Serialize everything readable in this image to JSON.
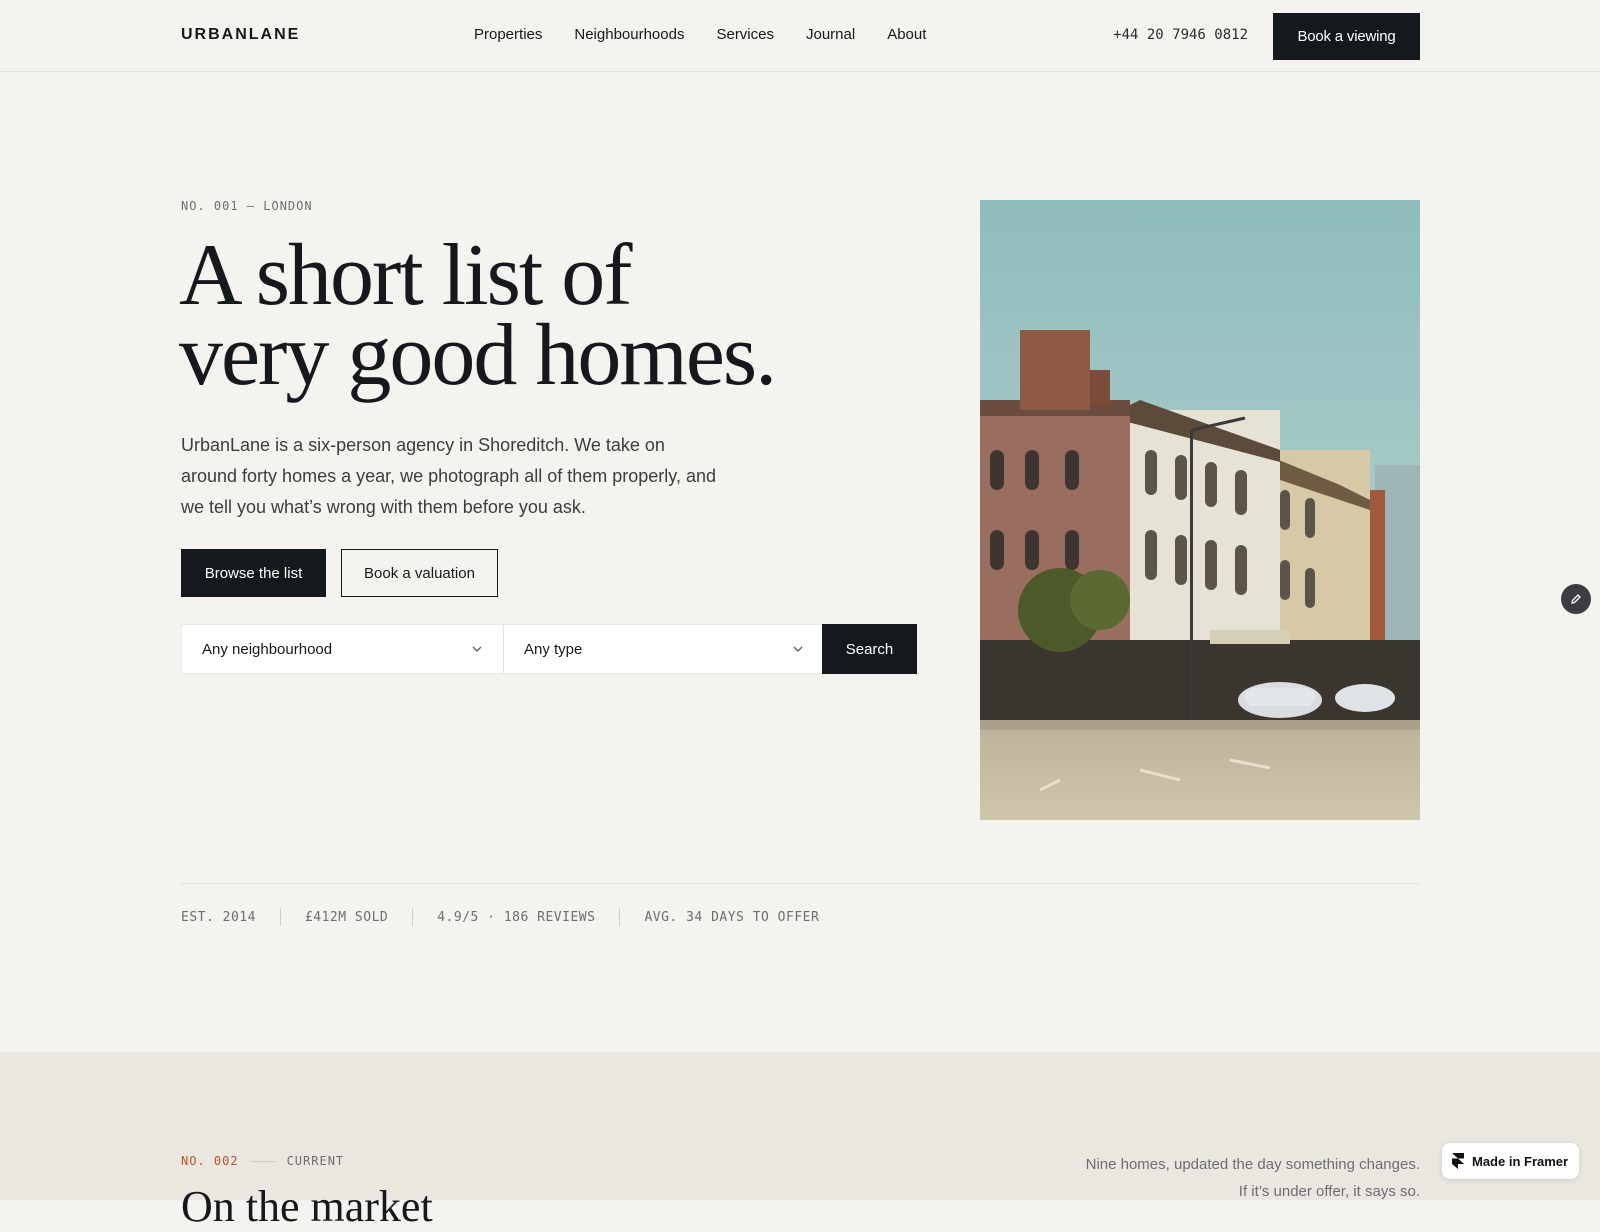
{
  "header": {
    "logo": "URBANLANE",
    "nav": [
      "Properties",
      "Neighbourhoods",
      "Services",
      "Journal",
      "About"
    ],
    "phone": "+44 20 7946 0812",
    "cta": "Book a viewing"
  },
  "hero": {
    "eyebrow": "NO. 001 — LONDON",
    "title_line1": "A short list of",
    "title_line2": "very good homes.",
    "description": "UrbanLane is a six-person agency in Shoreditch. We take on around forty homes a year, we photograph all of them properly, and we tell you what’s wrong with them before you ask.",
    "primary_button": "Browse the list",
    "secondary_button": "Book a valuation",
    "search": {
      "neighbourhood": "Any neighbourhood",
      "type": "Any type",
      "button": "Search"
    },
    "photo_icon": "street-photo"
  },
  "stats": [
    "EST. 2014",
    "£412M SOLD",
    "4.9/5 · 186 REVIEWS",
    "AVG. 34 DAYS TO OFFER"
  ],
  "section2": {
    "number": "NO. 002",
    "label": "CURRENT",
    "title": "On the market",
    "note_line1": "Nine homes, updated the day something changes.",
    "note_line2": "If it’s under offer, it says so."
  },
  "badge": {
    "label": "Made in Framer"
  },
  "colors": {
    "background": "#f5f3ef",
    "ink": "#15181d",
    "accent": "#b5532b",
    "section_bg": "#ebe6e0"
  }
}
